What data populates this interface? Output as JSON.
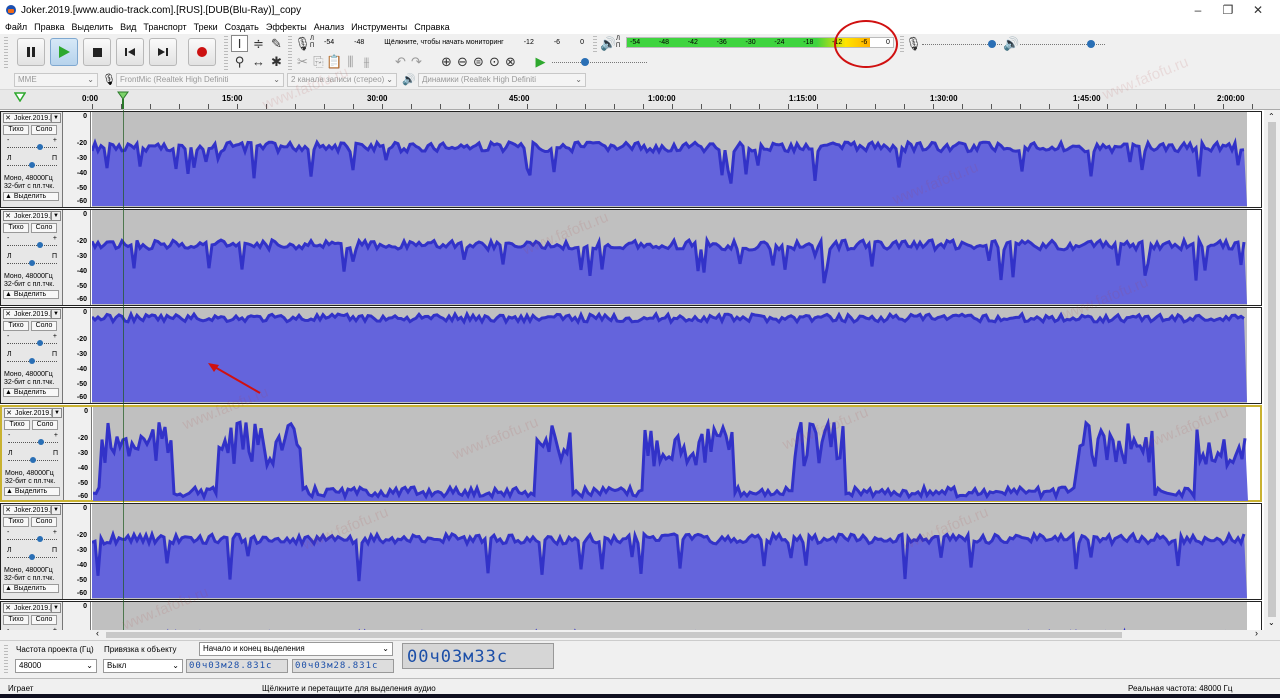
{
  "window": {
    "title": "Joker.2019.[www.audio-track.com].[RUS].[DUB(Blu-Ray)]_copy",
    "minimize": "–",
    "maximize": "❐",
    "close": "✕"
  },
  "menu": [
    "Файл",
    "Правка",
    "Выделить",
    "Вид",
    "Транспорт",
    "Треки",
    "Создать",
    "Эффекты",
    "Анализ",
    "Инструменты",
    "Справка"
  ],
  "toolbar": {
    "rec_meter_l": "Л",
    "rec_meter_r": "П",
    "rec_meter_scale": [
      "-54",
      "-48",
      "Щёлкните, чтобы начать мониторинг",
      "-12",
      "-6",
      "0"
    ],
    "play_meter_scale": [
      "-54",
      "-48",
      "-42",
      "-36",
      "-30",
      "-24",
      "-18",
      "-12",
      "-6",
      "0"
    ],
    "play_meter_level": 0.915,
    "rec_volume": 0.92,
    "play_volume": 0.87,
    "speed": 0.33
  },
  "devices": {
    "host": "MME",
    "input": "FrontMic (Realtek High Definiti",
    "channels": "2 канала записи (стерео)",
    "output": "Динамики (Realtek High Definiti"
  },
  "timeline": {
    "labels": [
      "0:00",
      "15:00",
      "30:00",
      "45:00",
      "1:00:00",
      "1:15:00",
      "1:30:00",
      "1:45:00",
      "2:00:00"
    ]
  },
  "track_common": {
    "name": "Joker.2019.[",
    "mute": "Тихо",
    "solo": "Соло",
    "gain_minus": "-",
    "gain_plus": "+",
    "pan_l": "Л",
    "pan_r": "П",
    "info1": "Моно, 48000Гц",
    "info2": "32-бит с пл.тчк.",
    "select": "Выделить",
    "scale": [
      "0",
      "-20",
      "-30",
      "-40",
      "-50",
      "-60"
    ]
  },
  "tracks": [
    {
      "id": 1,
      "style": "dense",
      "focused": false
    },
    {
      "id": 2,
      "style": "dense",
      "focused": false
    },
    {
      "id": 3,
      "style": "loud",
      "focused": false
    },
    {
      "id": 4,
      "style": "sparse",
      "focused": true
    },
    {
      "id": 5,
      "style": "dense",
      "focused": false
    },
    {
      "id": 6,
      "style": "dense",
      "focused": false
    }
  ],
  "selection": {
    "rate_label": "Частота проекта (Гц)",
    "rate_value": "48000",
    "snap_label": "Привязка к объекту",
    "snap_value": "Выкл",
    "range_label": "Начало и конец выделения",
    "start_time": "00ч03м28.831с",
    "end_time": "00ч03м28.831с",
    "position": "00ч03м33с"
  },
  "status": {
    "state": "Играет",
    "hint": "Щёлкните и перетащите для выделения аудио",
    "rate": "Реальная частота: 48000 Гц"
  },
  "watermark": "www.fafofu.ru",
  "colors": {
    "waveform": "#3232c8",
    "waveform_rms": "#6464dc",
    "track_bg": "#c0c0c0",
    "meter_green": "#3fd43f",
    "meter_yellow": "#ffe400",
    "annotation": "#d01010",
    "focus": "#c9b230"
  }
}
